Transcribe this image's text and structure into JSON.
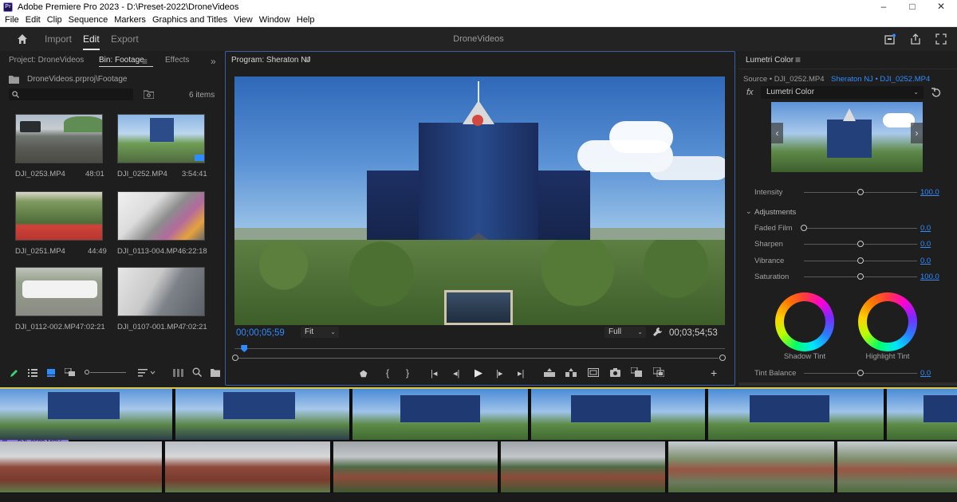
{
  "app": {
    "title": "Adobe Premiere Pro 2023 - D:\\Preset-2022\\DroneVideos",
    "icon_text": "Pr"
  },
  "window_controls": {
    "minimize": "–",
    "maximize": "□",
    "close": "✕"
  },
  "menu": [
    "File",
    "Edit",
    "Clip",
    "Sequence",
    "Markers",
    "Graphics and Titles",
    "View",
    "Window",
    "Help"
  ],
  "header": {
    "tabs": [
      "Import",
      "Edit",
      "Export"
    ],
    "active_tab": "Edit",
    "project_name": "DroneVideos"
  },
  "project_panel": {
    "tabs": [
      "Project: DroneVideos",
      "Bin: Footage",
      "Effects"
    ],
    "active_tab": "Bin: Footage",
    "overflow": "»",
    "path": "DroneVideos.prproj\\Footage",
    "item_count": "6 items",
    "clips": [
      {
        "name": "DJI_0253.MP4",
        "duration": "48:01"
      },
      {
        "name": "DJI_0252.MP4",
        "duration": "3:54:41"
      },
      {
        "name": "DJI_0251.MP4",
        "duration": "44:49"
      },
      {
        "name": "DJI_0113-004.MP4",
        "duration": "6:22:18"
      },
      {
        "name": "DJI_0112-002.MP4",
        "duration": "7:02:21"
      },
      {
        "name": "DJI_0107-001.MP4",
        "duration": "7:02:21"
      }
    ]
  },
  "program_monitor": {
    "title": "Program: Sheraton NJ",
    "timecode_current": "00;00;05;59",
    "zoom": "Fit",
    "resolution": "Full",
    "timecode_total": "00;03;54;53",
    "playhead_progress": 0.02
  },
  "lumetri": {
    "title": "Lumetri Color",
    "source": "Source • DJI_0252.MP4",
    "sequence_clip": "Sheraton NJ • DJI_0252.MP4",
    "fx_label": "fx",
    "effect": "Lumetri Color",
    "intensity": {
      "label": "Intensity",
      "value": "100.0",
      "level": 0.5
    },
    "adjustments_title": "Adjustments",
    "adjustments": [
      {
        "label": "Faded Film",
        "value": "0.0",
        "level": 0.0
      },
      {
        "label": "Sharpen",
        "value": "0.0",
        "level": 0.5
      },
      {
        "label": "Vibrance",
        "value": "0.0",
        "level": 0.5
      },
      {
        "label": "Saturation",
        "value": "100.0",
        "level": 0.5
      }
    ],
    "wheels": [
      "Shadow Tint",
      "Highlight Tint"
    ],
    "tint_balance": {
      "label": "Tint Balance",
      "value": "0.0",
      "level": 0.5
    }
  },
  "timeline": {
    "track2_label": "DJI_0689.MOV"
  },
  "colors": {
    "accent": "#2f8cff",
    "panel_bg": "#1e1e1e",
    "program_border": "#3a5fa5",
    "video_clip_label": "#8b73d8"
  }
}
